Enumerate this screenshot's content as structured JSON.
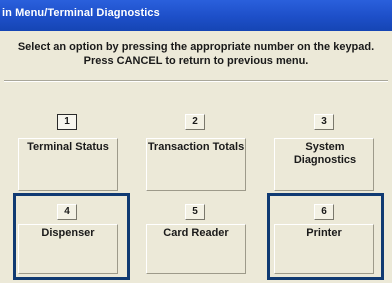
{
  "window": {
    "title": "in Menu/Terminal Diagnostics"
  },
  "instructions": {
    "line1": "Select an option by pressing the appropriate number on the keypad.",
    "line2": "Press CANCEL to return to previous menu."
  },
  "options": [
    {
      "number": "1",
      "label": "Terminal Status"
    },
    {
      "number": "2",
      "label": "Transaction Totals"
    },
    {
      "number": "3",
      "label": "System Diagnostics"
    },
    {
      "number": "4",
      "label": "Dispenser"
    },
    {
      "number": "5",
      "label": "Card Reader"
    },
    {
      "number": "6",
      "label": "Printer"
    }
  ],
  "colors": {
    "title_bar": "#1d4fc8",
    "highlight": "#103a72",
    "background": "#ece9d8"
  }
}
